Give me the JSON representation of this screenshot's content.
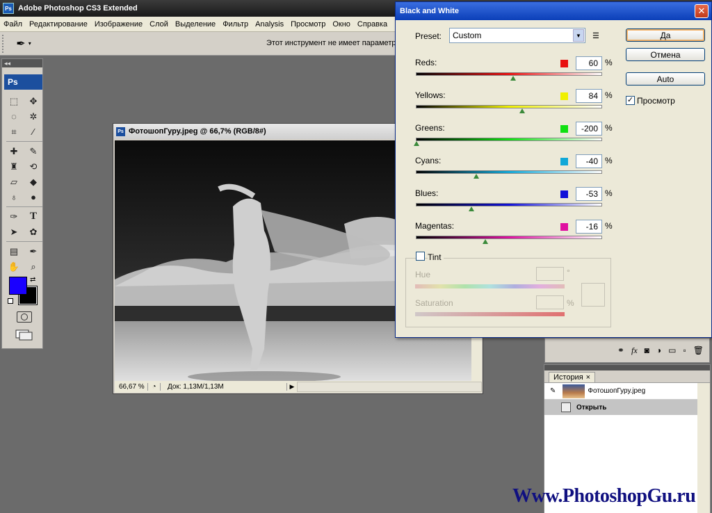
{
  "app": {
    "title": "Adobe Photoshop CS3 Extended",
    "logo": "Ps"
  },
  "menu": [
    "Файл",
    "Редактирование",
    "Изображение",
    "Слой",
    "Выделение",
    "Фильтр",
    "Analysis",
    "Просмотр",
    "Окно",
    "Справка"
  ],
  "options": {
    "message": "Этот инструмент не имеет параметров"
  },
  "toolbox": {
    "badge": "Ps",
    "fg_color": "#1a00ff",
    "bg_color": "#000000",
    "tools": [
      "marquee-icon",
      "move-icon",
      "lasso-icon",
      "magic-wand-icon",
      "crop-icon",
      "slice-icon",
      "healing-brush-icon",
      "brush-icon",
      "clone-stamp-icon",
      "history-brush-icon",
      "eraser-icon",
      "paint-bucket-icon",
      "blur-icon",
      "dodge-icon",
      "pen-icon",
      "type-icon",
      "path-selection-icon",
      "shape-icon",
      "notes-icon",
      "eyedropper-icon",
      "hand-icon",
      "zoom-icon"
    ]
  },
  "document": {
    "title": "ФотошопГуру.jpeg @ 66,7% (RGB/8#)",
    "zoom": "66,67 %",
    "info": "Док: 1,13M/1,13M"
  },
  "bw_dialog": {
    "title": "Black and White",
    "preset_label": "Preset:",
    "preset_value": "Custom",
    "sliders": [
      {
        "name": "Reds",
        "label": "Reds:",
        "value": "60",
        "color": "#e81010",
        "min": -200,
        "max": 300
      },
      {
        "name": "Yellows",
        "label": "Yellows:",
        "value": "84",
        "color": "#f0f000",
        "min": -200,
        "max": 300
      },
      {
        "name": "Greens",
        "label": "Greens:",
        "value": "-200",
        "color": "#10e010",
        "min": -200,
        "max": 300
      },
      {
        "name": "Cyans",
        "label": "Cyans:",
        "value": "-40",
        "color": "#10a8d8",
        "min": -200,
        "max": 300
      },
      {
        "name": "Blues",
        "label": "Blues:",
        "value": "-53",
        "color": "#1010d8",
        "min": -200,
        "max": 300
      },
      {
        "name": "Magentas",
        "label": "Magentas:",
        "value": "-16",
        "color": "#e010a0",
        "min": -200,
        "max": 300
      }
    ],
    "percent": "%",
    "tint_label": "Tint",
    "hue_label": "Hue",
    "hue_unit": "°",
    "saturation_label": "Saturation",
    "saturation_unit": "%",
    "ok_label": "Да",
    "cancel_label": "Отмена",
    "auto_label": "Auto",
    "preview_label": "Просмотр",
    "preview_checked": true
  },
  "history": {
    "tab": "История",
    "snapshot": "ФотошопГуру.jpeg",
    "step": "Открыть"
  },
  "watermark": "Www.PhotoshopGu.ru"
}
